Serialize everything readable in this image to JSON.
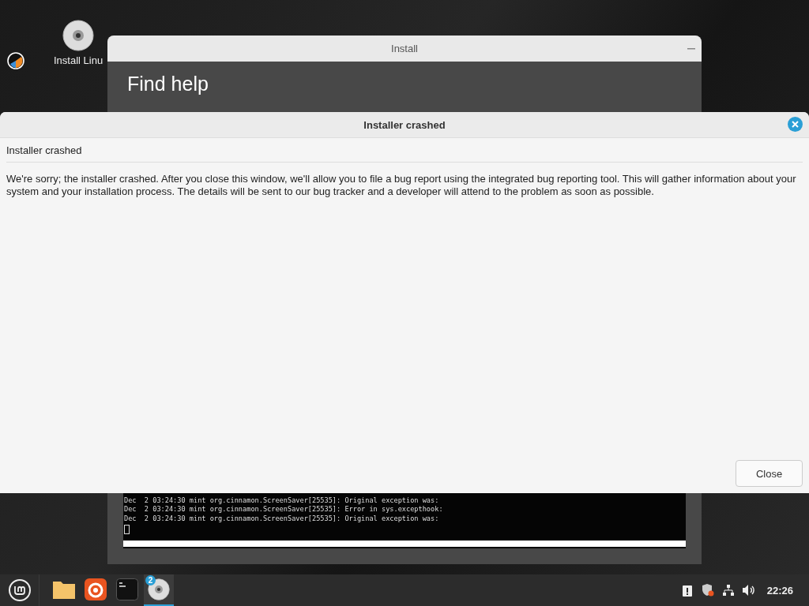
{
  "desktop": {
    "icons": [
      {
        "kind": "app"
      },
      {
        "kind": "disc",
        "label": "Install Linu"
      }
    ]
  },
  "install_window": {
    "title": "Install",
    "heading": "Find help",
    "terminal_lines": [
      "Dec  2 03:24:30 mint org.cinnamon.ScreenSaver[25535]: Original exception was:",
      "Dec  2 03:24:30 mint org.cinnamon.ScreenSaver[25535]: Error in sys.excepthook:",
      "Dec  2 03:24:30 mint org.cinnamon.ScreenSaver[25535]: Original exception was:"
    ]
  },
  "dialog": {
    "title": "Installer crashed",
    "header": "Installer crashed",
    "message": "We're sorry; the installer crashed. After you close this window, we'll allow you to file a bug report using the integrated bug reporting tool. This will gather information about your system and your installation process. The details will be sent to our bug tracker and a developer will attend to the problem as soon as possible.",
    "buttons": [
      "Close"
    ]
  },
  "taskbar": {
    "launchers": [
      {
        "kind": "folder",
        "selected": false
      },
      {
        "kind": "browser",
        "selected": false
      },
      {
        "kind": "terminal",
        "selected": false
      },
      {
        "kind": "disc",
        "selected": true,
        "badge": "2"
      }
    ],
    "clock": "22:26"
  }
}
